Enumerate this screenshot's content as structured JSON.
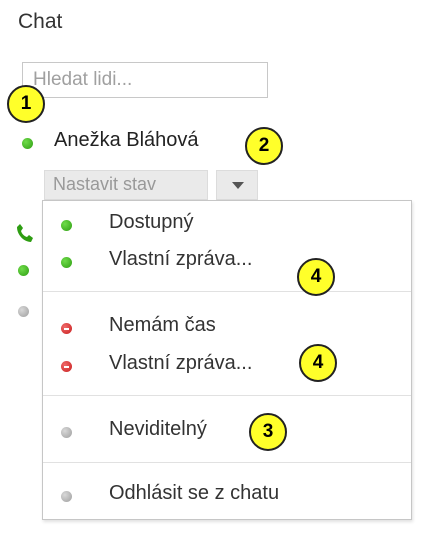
{
  "title": "Chat",
  "search": {
    "placeholder": "Hledat lidi..."
  },
  "user": {
    "name": "Anežka Bláhová",
    "status_color": "#3aa81e"
  },
  "set_status": {
    "label": "Nastavit stav"
  },
  "menu": {
    "available": {
      "label": "Dostupný"
    },
    "available_custom": {
      "label": "Vlastní zpráva..."
    },
    "busy": {
      "label": "Nemám čas"
    },
    "busy_custom": {
      "label": "Vlastní zpráva..."
    },
    "invisible": {
      "label": "Neviditelný"
    },
    "sign_out": {
      "label": "Odhlásit se z chatu"
    }
  },
  "callouts": {
    "c1": "1",
    "c2": "2",
    "c3": "3",
    "c4a": "4",
    "c4b": "4"
  },
  "colors": {
    "available": "#3aa81e",
    "busy": "#d32f2f",
    "offline": "#a8a8a8",
    "callout": "#ffff2a"
  }
}
